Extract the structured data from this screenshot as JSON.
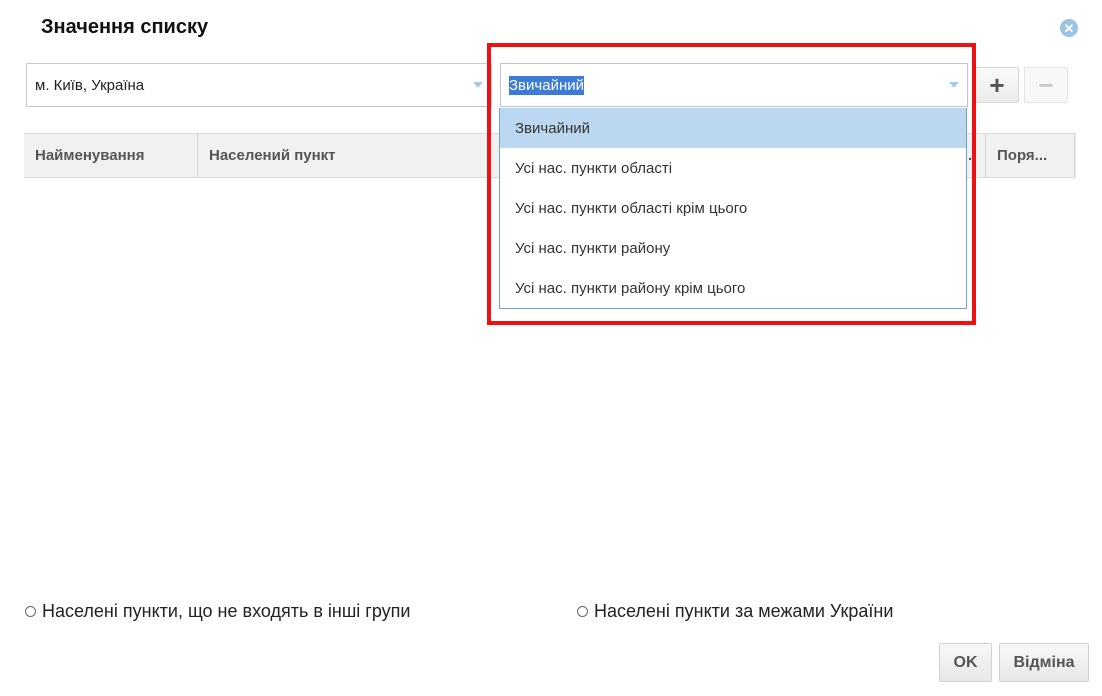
{
  "dialog": {
    "title": "Значення списку",
    "close_icon": "close-icon"
  },
  "location_select": {
    "value": "м. Київ, Україна"
  },
  "type_select": {
    "value": "Звичайний",
    "options": [
      "Звичайний",
      "Усі нас. пункти області",
      "Усі нас. пункти області крім цього",
      "Усі нас. пункти району",
      "Усі нас. пункти району крім цього"
    ],
    "selected_index": 0
  },
  "toolbar": {
    "add_label": "+",
    "remove_label": "−"
  },
  "grid": {
    "columns": [
      "Найменування",
      "Населений пункт",
      ".",
      "Поря..."
    ]
  },
  "radios": [
    "Населені пункти, що не входять в інші групи",
    "Населені пункти за межами України"
  ],
  "buttons": {
    "ok": "OK",
    "cancel": "Відміна"
  },
  "colors": {
    "highlight_frame": "#ee1111",
    "selected_option": "#bcd8f0",
    "text_selection": "#3d7cd6"
  }
}
